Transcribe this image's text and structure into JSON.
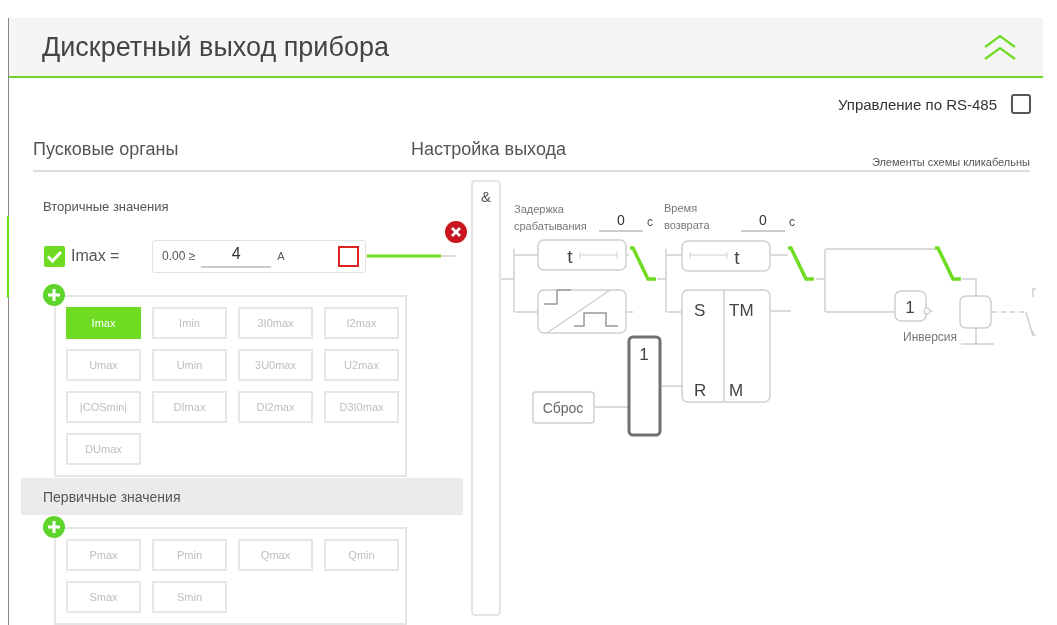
{
  "title": "Дискретный выход прибора",
  "rs485": {
    "label": "Управление по RS-485",
    "checked": false
  },
  "sections": {
    "left": "Пусковые органы",
    "right": "Настройка выхода",
    "hint": "Элементы схемы кликабельны"
  },
  "secondary": {
    "heading": "Вторичные значения",
    "condition": {
      "enabled": true,
      "name": "Imax =",
      "min": "0.00 ≥",
      "value": "4",
      "unit": "A",
      "flag": false
    },
    "buttons": [
      {
        "label": "Imax",
        "selected": true
      },
      {
        "label": "Imin",
        "selected": false
      },
      {
        "label": "3I0max",
        "selected": false
      },
      {
        "label": "I2max",
        "selected": false
      },
      {
        "label": "Umax",
        "selected": false
      },
      {
        "label": "Umin",
        "selected": false
      },
      {
        "label": "3U0max",
        "selected": false
      },
      {
        "label": "U2max",
        "selected": false
      },
      {
        "label": "|COSmin|",
        "selected": false
      },
      {
        "label": "DImax",
        "selected": false
      },
      {
        "label": "DI2max",
        "selected": false
      },
      {
        "label": "D3I0max",
        "selected": false
      },
      {
        "label": "DUmax",
        "selected": false
      }
    ]
  },
  "primary": {
    "heading": "Первичные значения",
    "buttons": [
      {
        "label": "Pmax",
        "selected": false
      },
      {
        "label": "Pmin",
        "selected": false
      },
      {
        "label": "Qmax",
        "selected": false
      },
      {
        "label": "Qmin",
        "selected": false
      },
      {
        "label": "Smax",
        "selected": false
      },
      {
        "label": "Smin",
        "selected": false
      }
    ]
  },
  "diagram": {
    "and_label": "&",
    "pickup": {
      "label": "Задержка срабатывания",
      "value": "0",
      "unit": "с",
      "timer": "t"
    },
    "dropout": {
      "label": "Время возврата",
      "value": "0",
      "unit": "с",
      "timer": "t"
    },
    "latch": {
      "s": "S",
      "tm": "TM",
      "r": "R",
      "m": "M"
    },
    "or_label": "1",
    "reset": "Сброс",
    "inverter": {
      "label": "1",
      "caption": "Инверсия"
    }
  }
}
